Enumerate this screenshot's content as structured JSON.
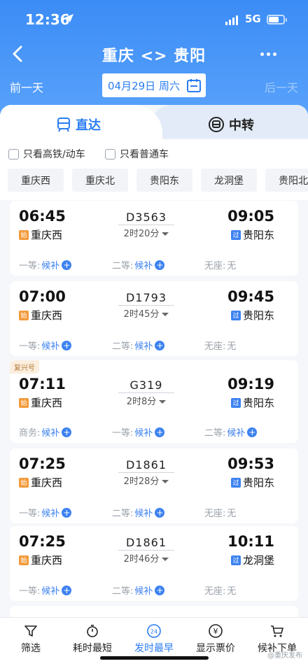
{
  "status_bar": {
    "time": "12:36",
    "network": "5G"
  },
  "header": {
    "title": "重庆 <> 贵阳",
    "prev_day": "前一天",
    "next_day": "后一天",
    "date": "04月29日 周六"
  },
  "tabs": [
    {
      "label": "直达"
    },
    {
      "label": "中转"
    }
  ],
  "filters": [
    {
      "label": "只看高铁/动车"
    },
    {
      "label": "只看普通车"
    }
  ],
  "stations": [
    "重庆西",
    "重庆北",
    "贵阳东",
    "龙洞堡",
    "贵阳北"
  ],
  "trains": [
    {
      "tag": "",
      "dep": "06:45",
      "arr": "09:05",
      "no": "D3563",
      "dur": "2时20分",
      "from": "重庆西",
      "from_badge": "始",
      "to": "贵阳东",
      "to_badge": "过",
      "seats": [
        {
          "name": "一等:",
          "val": "候补",
          "plus": true
        },
        {
          "name": "二等:",
          "val": "候补",
          "plus": true
        },
        {
          "name": "无座:",
          "val": "无",
          "plus": false
        }
      ]
    },
    {
      "tag": "",
      "dep": "07:00",
      "arr": "09:45",
      "no": "D1793",
      "dur": "2时45分",
      "from": "重庆西",
      "from_badge": "始",
      "to": "贵阳东",
      "to_badge": "过",
      "seats": [
        {
          "name": "一等:",
          "val": "候补",
          "plus": true
        },
        {
          "name": "二等:",
          "val": "候补",
          "plus": true
        },
        {
          "name": "无座:",
          "val": "无",
          "plus": false
        }
      ]
    },
    {
      "tag": "复兴号",
      "dep": "07:11",
      "arr": "09:19",
      "no": "G319",
      "dur": "2时8分",
      "from": "重庆西",
      "from_badge": "始",
      "to": "贵阳东",
      "to_badge": "过",
      "seats": [
        {
          "name": "商务:",
          "val": "候补",
          "plus": true
        },
        {
          "name": "一等:",
          "val": "候补",
          "plus": true
        },
        {
          "name": "二等:",
          "val": "候补",
          "plus": true
        }
      ]
    },
    {
      "tag": "",
      "dep": "07:25",
      "arr": "09:53",
      "no": "D1861",
      "dur": "2时28分",
      "from": "重庆西",
      "from_badge": "始",
      "to": "贵阳东",
      "to_badge": "过",
      "seats": [
        {
          "name": "一等:",
          "val": "候补",
          "plus": true
        },
        {
          "name": "二等:",
          "val": "候补",
          "plus": true
        },
        {
          "name": "无座:",
          "val": "无",
          "plus": false
        }
      ]
    },
    {
      "tag": "",
      "dep": "07:25",
      "arr": "10:11",
      "no": "D1861",
      "dur": "2时46分",
      "from": "重庆西",
      "from_badge": "始",
      "to": "龙洞堡",
      "to_badge": "过",
      "seats": [
        {
          "name": "一等:",
          "val": "候补",
          "plus": true
        },
        {
          "name": "二等:",
          "val": "候补",
          "plus": true
        },
        {
          "name": "无座:",
          "val": "无",
          "plus": false
        }
      ]
    }
  ],
  "bottom_nav": [
    {
      "label": "筛选",
      "icon": "filter-icon"
    },
    {
      "label": "耗时最短",
      "icon": "timer-icon"
    },
    {
      "label": "发时最早",
      "icon": "clock-24-icon",
      "icon_text": "24"
    },
    {
      "label": "显示票价",
      "icon": "yen-icon",
      "icon_text": "¥"
    },
    {
      "label": "候补下单",
      "icon": "cart-icon"
    }
  ],
  "watermark": "@重庆发布",
  "colors": {
    "primary": "#3d82f0",
    "header": "#3b8cf6",
    "start_badge": "#f39a3a",
    "tag_bg": "#fbeede"
  }
}
